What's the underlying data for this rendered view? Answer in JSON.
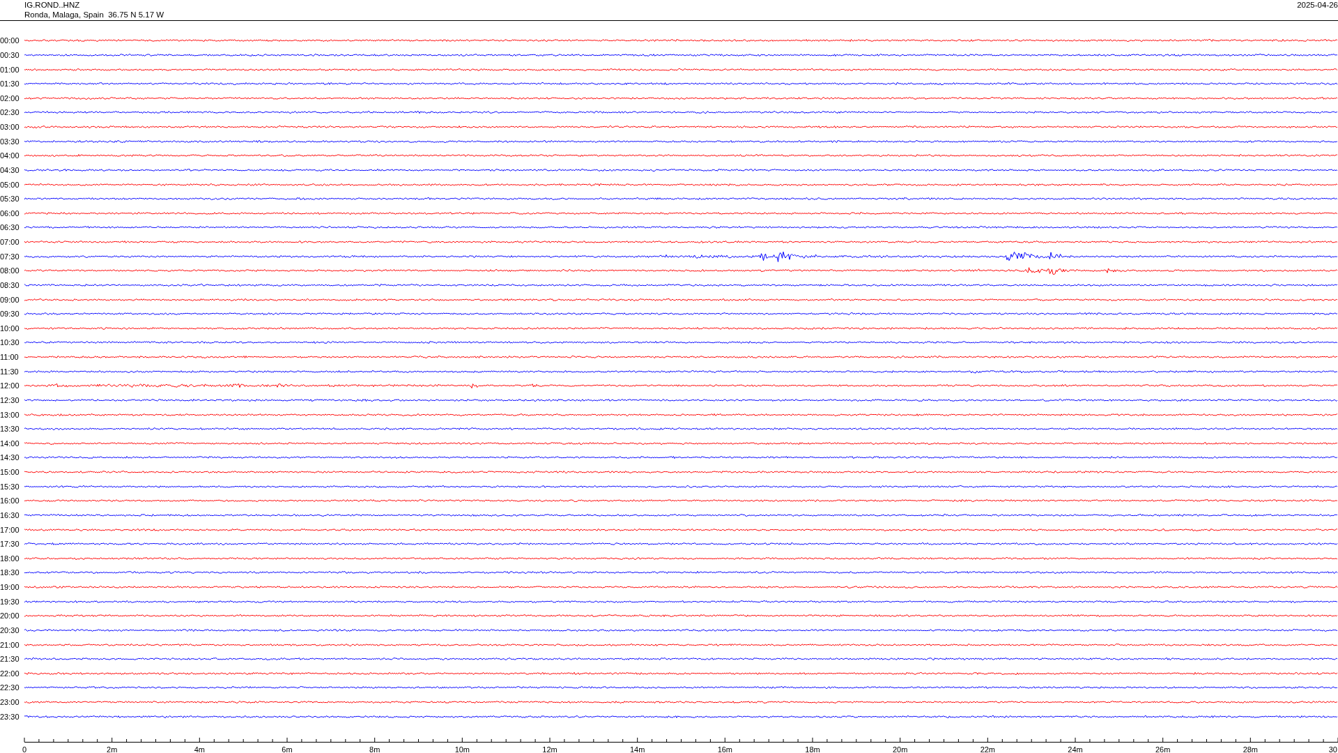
{
  "header": {
    "station": "IG.ROND..HNZ",
    "location": "Ronda, Malaga, Spain  36.75 N 5.17 W",
    "date": "2025-04-26"
  },
  "rows": [
    {
      "time": "00:00",
      "color": "#ff0000"
    },
    {
      "time": "00:30",
      "color": "#0000ff"
    },
    {
      "time": "01:00",
      "color": "#ff0000"
    },
    {
      "time": "01:30",
      "color": "#0000ff"
    },
    {
      "time": "02:00",
      "color": "#ff0000"
    },
    {
      "time": "02:30",
      "color": "#0000ff"
    },
    {
      "time": "03:00",
      "color": "#ff0000"
    },
    {
      "time": "03:30",
      "color": "#0000ff"
    },
    {
      "time": "04:00",
      "color": "#ff0000"
    },
    {
      "time": "04:30",
      "color": "#0000ff"
    },
    {
      "time": "05:00",
      "color": "#ff0000"
    },
    {
      "time": "05:30",
      "color": "#0000ff"
    },
    {
      "time": "06:00",
      "color": "#ff0000"
    },
    {
      "time": "06:30",
      "color": "#0000ff"
    },
    {
      "time": "07:00",
      "color": "#ff0000"
    },
    {
      "time": "07:30",
      "color": "#0000ff"
    },
    {
      "time": "08:00",
      "color": "#ff0000"
    },
    {
      "time": "08:30",
      "color": "#0000ff"
    },
    {
      "time": "09:00",
      "color": "#ff0000"
    },
    {
      "time": "09:30",
      "color": "#0000ff"
    },
    {
      "time": "10:00",
      "color": "#ff0000"
    },
    {
      "time": "10:30",
      "color": "#0000ff"
    },
    {
      "time": "11:00",
      "color": "#ff0000"
    },
    {
      "time": "11:30",
      "color": "#0000ff"
    },
    {
      "time": "12:00",
      "color": "#ff0000"
    },
    {
      "time": "12:30",
      "color": "#0000ff"
    },
    {
      "time": "13:00",
      "color": "#ff0000"
    },
    {
      "time": "13:30",
      "color": "#0000ff"
    },
    {
      "time": "14:00",
      "color": "#ff0000"
    },
    {
      "time": "14:30",
      "color": "#0000ff"
    },
    {
      "time": "15:00",
      "color": "#ff0000"
    },
    {
      "time": "15:30",
      "color": "#0000ff"
    },
    {
      "time": "16:00",
      "color": "#ff0000"
    },
    {
      "time": "16:30",
      "color": "#0000ff"
    },
    {
      "time": "17:00",
      "color": "#ff0000"
    },
    {
      "time": "17:30",
      "color": "#0000ff"
    },
    {
      "time": "18:00",
      "color": "#ff0000"
    },
    {
      "time": "18:30",
      "color": "#0000ff"
    },
    {
      "time": "19:00",
      "color": "#ff0000"
    },
    {
      "time": "19:30",
      "color": "#0000ff"
    },
    {
      "time": "20:00",
      "color": "#ff0000"
    },
    {
      "time": "20:30",
      "color": "#0000ff"
    },
    {
      "time": "21:00",
      "color": "#ff0000"
    },
    {
      "time": "21:30",
      "color": "#0000ff"
    },
    {
      "time": "22:00",
      "color": "#ff0000"
    },
    {
      "time": "22:30",
      "color": "#0000ff"
    },
    {
      "time": "23:00",
      "color": "#ff0000"
    },
    {
      "time": "23:30",
      "color": "#0000ff"
    }
  ],
  "axis": {
    "labels": [
      "0",
      "2m",
      "4m",
      "6m",
      "8m",
      "10m",
      "12m",
      "14m",
      "16m",
      "18m",
      "20m",
      "22m",
      "24m",
      "26m",
      "28m",
      "30"
    ]
  }
}
